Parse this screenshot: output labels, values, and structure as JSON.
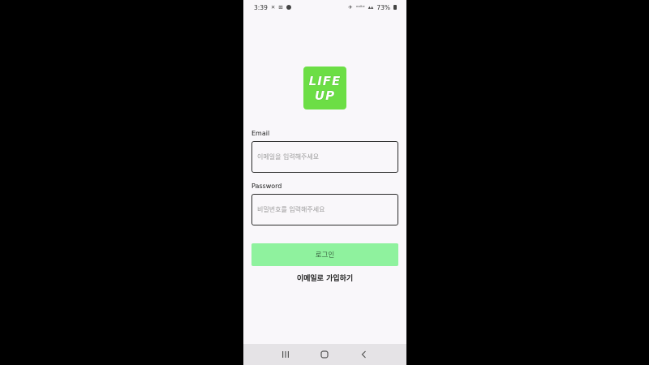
{
  "status_bar": {
    "time": "3:39",
    "left_icons": [
      "✕",
      "⊞"
    ],
    "right_icons": [
      "✈",
      "ᵛᵒˡᵗᵉ",
      "▴▴"
    ],
    "battery": "73%"
  },
  "logo": {
    "line1": "LIFE",
    "line2": "UP"
  },
  "form": {
    "email_label": "Email",
    "email_placeholder": "이메일을 입력해주세요",
    "password_label": "Password",
    "password_placeholder": "비밀번호를 입력해주세요",
    "login_button": "로그인",
    "signup_link": "이메일로 가입하기"
  },
  "colors": {
    "logo_bg": "#6cde45",
    "login_bg": "#8ff29e",
    "screen_bg": "#f9f7fa"
  },
  "nav_bar": {
    "icons": [
      "recent-apps-icon",
      "home-icon",
      "back-icon"
    ]
  }
}
